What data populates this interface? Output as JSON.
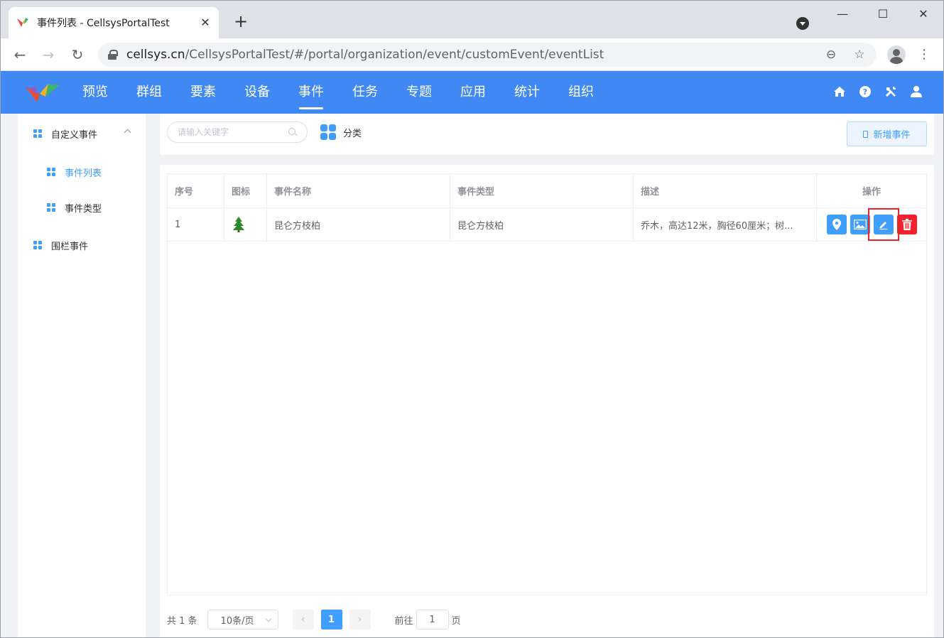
{
  "browser": {
    "tab_title": "事件列表 - CellsysPortalTest",
    "url_host": "cellsys.cn",
    "url_path": "/CellsysPortalTest/#/portal/organization/event/customEvent/eventList"
  },
  "header": {
    "nav": [
      "预览",
      "群组",
      "要素",
      "设备",
      "事件",
      "任务",
      "专题",
      "应用",
      "统计",
      "组织"
    ],
    "active": "事件",
    "bg_color": "#4088f4"
  },
  "sidebar": {
    "group1": "自定义事件",
    "sub1": "事件列表",
    "sub2": "事件类型",
    "group2": "围栏事件"
  },
  "toolbar": {
    "search_placeholder": "请输入关键字",
    "category_label": "分类",
    "add_button": "新增事件"
  },
  "table": {
    "headers": [
      "序号",
      "图标",
      "事件名称",
      "事件类型",
      "描述",
      "操作"
    ],
    "rows": [
      {
        "index": "1",
        "icon": "pine-tree-icon",
        "name": "昆仑方枝柏",
        "type": "昆仑方枝柏",
        "desc": "乔木，高达12米，胸径60厘米；树..."
      }
    ]
  },
  "pagination": {
    "total": "共 1 条",
    "page_size": "10条/页",
    "current_page": "1",
    "goto_prefix": "前往",
    "goto_value": "1",
    "goto_suffix": "页"
  }
}
